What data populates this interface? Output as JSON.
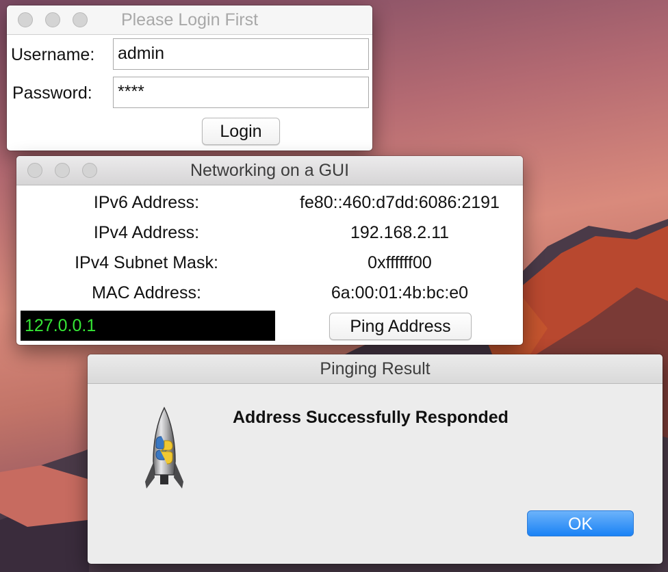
{
  "login_window": {
    "title": "Please Login First",
    "username_label": "Username:",
    "username_value": "admin",
    "password_label": "Password:",
    "password_value": "****",
    "login_button": "Login"
  },
  "network_window": {
    "title": "Networking on a GUI",
    "rows": [
      {
        "label": "IPv6 Address:",
        "value": "fe80::460:d7dd:6086:2191"
      },
      {
        "label": "IPv4 Address:",
        "value": "192.168.2.11"
      },
      {
        "label": "IPv4 Subnet Mask:",
        "value": "0xffffff00"
      },
      {
        "label": "MAC Address:",
        "value": "6a:00:01:4b:bc:e0"
      }
    ],
    "ping_entry_value": "127.0.0.1",
    "ping_button": "Ping Address"
  },
  "dialog": {
    "title": "Pinging Result",
    "message": "Address Successfully Responded",
    "ok_button": "OK",
    "icon": "python-launcher-rocket-icon"
  },
  "colors": {
    "entry_bg": "#000000",
    "entry_text": "#35e635",
    "ok_button": "#1a82f5"
  }
}
